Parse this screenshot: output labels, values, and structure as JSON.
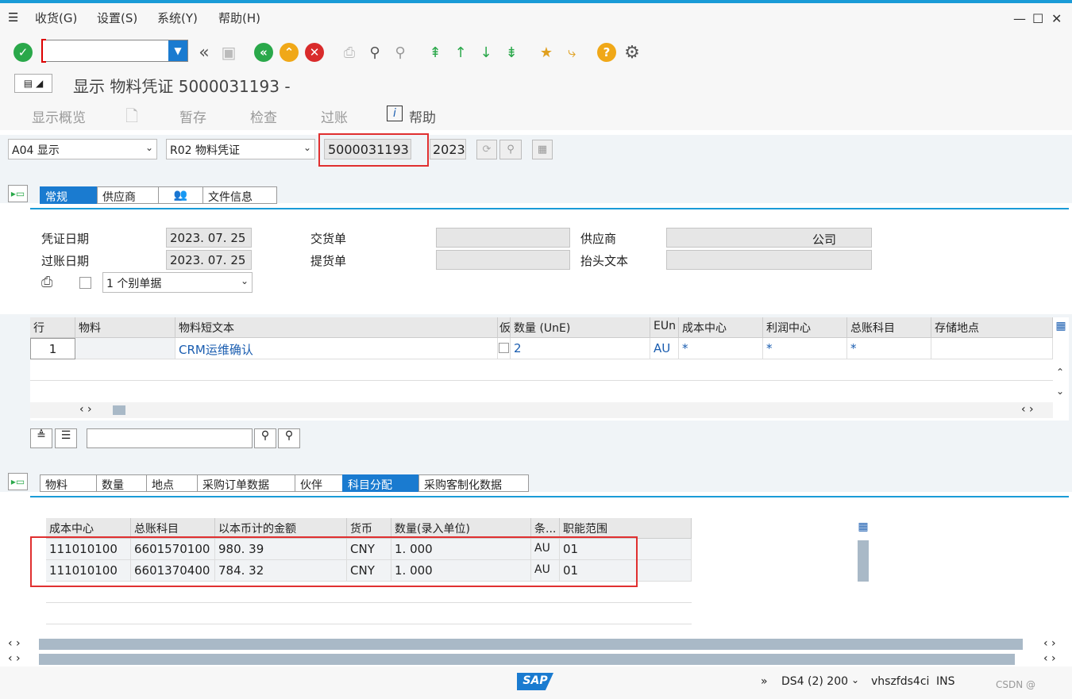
{
  "menu": {
    "items": [
      "收货(G)",
      "设置(S)",
      "系统(Y)",
      "帮助(H)"
    ]
  },
  "window": {
    "minimize": "—",
    "maximize": "☐",
    "close": "✕"
  },
  "title": {
    "text": "显示 物料凭证 5000031193 - "
  },
  "app_toolbar": {
    "overview": "显示概览",
    "hold": "暂存",
    "check": "检查",
    "post": "过账",
    "help": "帮助"
  },
  "selector": {
    "action": "A04 显示",
    "reference": "R02 物料凭证",
    "doc_number": "5000031193",
    "year": "2023"
  },
  "header_tabs": [
    "常规",
    "供应商",
    "",
    "文件信息"
  ],
  "header": {
    "doc_date_label": "凭证日期",
    "doc_date": "2023. 07. 25",
    "post_date_label": "过账日期",
    "post_date": "2023. 07. 25",
    "delivery_note_label": "交货单",
    "delivery_note": "",
    "bill_label": "提货单",
    "bill": "",
    "vendor_label": "供应商",
    "vendor": "公司",
    "header_text_label": "抬头文本",
    "header_text": "",
    "slip_option": "1 个别单据"
  },
  "items_table": {
    "headers": [
      "行",
      "物料",
      "物料短文本",
      "仮",
      "数量 (UnE)",
      "EUn",
      "成本中心",
      "利润中心",
      "总账科目",
      "存储地点"
    ],
    "rows": [
      [
        "1",
        "",
        "CRM运维确认",
        "",
        "2",
        "AU",
        "*",
        "*",
        "*",
        ""
      ]
    ]
  },
  "detail_tabs": [
    "物料",
    "数量",
    "地点",
    "采购订单数据",
    "伙伴",
    "科目分配",
    "采购客制化数据"
  ],
  "account_table": {
    "headers": [
      "成本中心",
      "总账科目",
      "以本币计的金额",
      "货币",
      "数量(录入单位)",
      "条...",
      "职能范围"
    ],
    "rows": [
      [
        "111010100",
        "6601570100",
        "980. 39",
        "CNY",
        "1. 000",
        "AU",
        "01"
      ],
      [
        "111010100",
        "6601370400",
        "784. 32",
        "CNY",
        "1. 000",
        "AU",
        "01"
      ]
    ]
  },
  "status": {
    "arrows": "»",
    "system": "DS4 (2) 200",
    "host": "vhszfds4ci",
    "mode": "INS",
    "watermark": "CSDN @"
  },
  "brand": {
    "logo": "SAP",
    "accent": "#1a7bd0",
    "highlight": "#e03030"
  }
}
